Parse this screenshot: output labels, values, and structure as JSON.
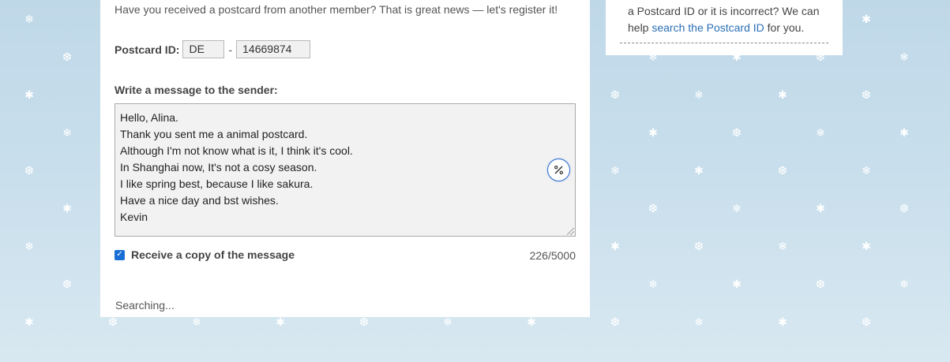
{
  "intro_text": "Have you received a postcard from another member? That is great news — let's register it!",
  "postcard_id": {
    "label": "Postcard ID:",
    "country_code": "DE",
    "separator": "-",
    "number": "14669874"
  },
  "message": {
    "label": "Write a message to the sender:",
    "lines": [
      "Hello, Alina.",
      "Thank you sent me a animal postcard.",
      "Although I'm not know what is it, I think it's cool.",
      "In Shanghai now, It's not a cosy season.",
      "I like spring best, because I like sakura.",
      "Have a nice day and bst wishes.",
      "Kevin"
    ],
    "char_count": "226/5000"
  },
  "copy_option": {
    "label": "Receive a copy of the message",
    "checked": true
  },
  "status_text": "Searching...",
  "sidebar": {
    "line1": "a Postcard ID or it is incorrect? We can",
    "help_prefix": "help ",
    "link_text": "search the Postcard ID",
    "help_suffix": " for you."
  },
  "colors": {
    "background": "#c9dfec",
    "link": "#2a6fb5",
    "checkbox": "#1a6fd6",
    "grammar_button_border": "#2d6fd1"
  },
  "icons": {
    "snowflake": "snowflake-icon",
    "grammar": "grammar-check-icon",
    "check": "checkmark-icon"
  }
}
